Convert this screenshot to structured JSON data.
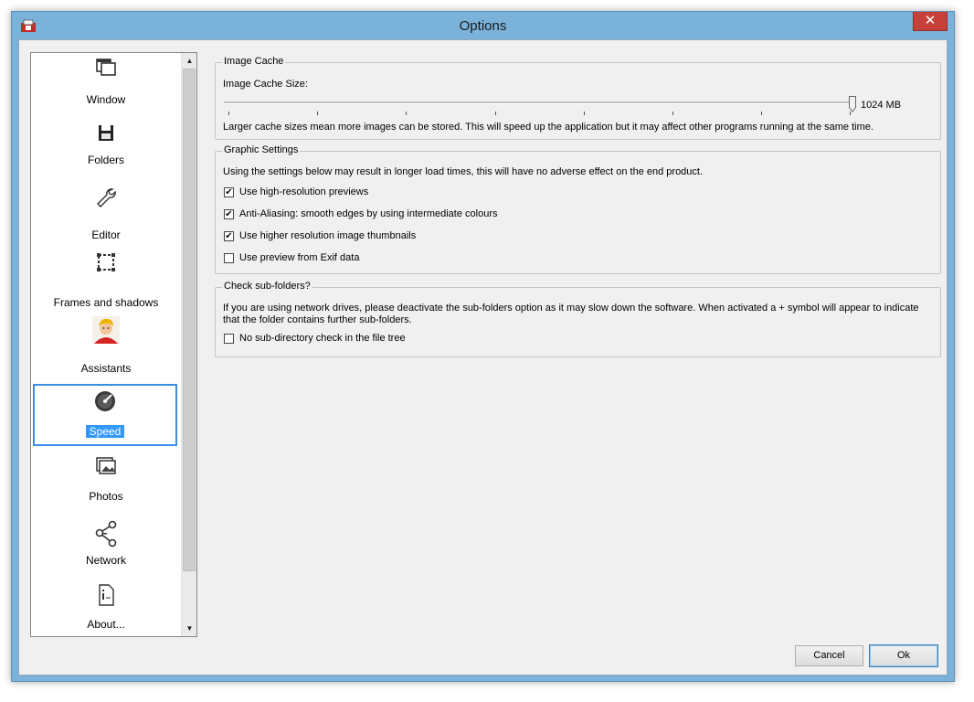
{
  "window": {
    "title": "Options",
    "close_glyph": "✕"
  },
  "sidebar": {
    "items": [
      {
        "label": "Window",
        "icon": "window-icon"
      },
      {
        "label": "Folders",
        "icon": "floppy-disk-icon"
      },
      {
        "label": "Editor",
        "icon": "wrench-icon"
      },
      {
        "label": "Frames and shadows",
        "icon": "frame-icon"
      },
      {
        "label": "Assistants",
        "icon": "assistant-avatar-icon"
      },
      {
        "label": "Speed",
        "icon": "speedometer-icon",
        "selected": true
      },
      {
        "label": "Photos",
        "icon": "photos-icon"
      },
      {
        "label": "Network",
        "icon": "network-icon"
      },
      {
        "label": "About...",
        "icon": "document-info-icon"
      }
    ]
  },
  "image_cache": {
    "title": "Image Cache",
    "size_label": "Image Cache Size:",
    "value_text": "1024 MB",
    "slider_fraction": 1.0,
    "description": "Larger cache sizes mean more images can be stored. This will speed up the application but it may affect other programs running at the same time."
  },
  "graphic_settings": {
    "title": "Graphic Settings",
    "description": "Using the settings below may result in longer load times, this will have no adverse effect on the end product.",
    "options": [
      {
        "label": "Use high-resolution previews",
        "checked": true
      },
      {
        "label": "Anti-Aliasing: smooth edges by using intermediate colours",
        "checked": true
      },
      {
        "label": "Use higher resolution image thumbnails",
        "checked": true
      },
      {
        "label": "Use preview from Exif data",
        "checked": false
      }
    ]
  },
  "subfolders": {
    "title": "Check sub-folders?",
    "description_line1": "If you are using network drives, please deactivate the sub-folders option as it may slow down the software. When activated a + symbol will appear to indicate",
    "description_line2": "that the folder contains further sub-folders.",
    "option": {
      "label": "No sub-directory check in the file tree",
      "checked": false
    }
  },
  "buttons": {
    "cancel": "Cancel",
    "ok": "Ok"
  },
  "colors": {
    "title_bar": "#7ab2d9",
    "close": "#c7403a",
    "selection": "#3399ff",
    "selection_border": "#3a8ee6"
  }
}
